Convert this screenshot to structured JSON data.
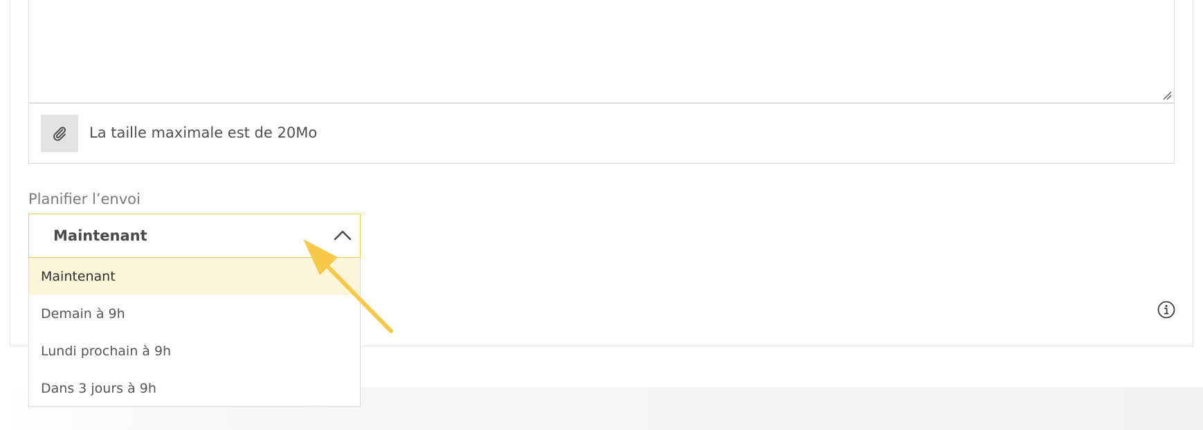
{
  "attachment": {
    "icon": "paperclip-icon",
    "hint": "La taille maximale est de 20Mo"
  },
  "schedule": {
    "label": "Planifier l’envoi",
    "selected_value": "Maintenant",
    "is_open": true,
    "options": [
      {
        "label": "Maintenant",
        "selected": true
      },
      {
        "label": "Demain à 9h",
        "selected": false
      },
      {
        "label": "Lundi prochain à 9h",
        "selected": false
      },
      {
        "label": "Dans 3 jours à 9h",
        "selected": false
      }
    ]
  },
  "icons": {
    "toggle": "chevron-up-icon",
    "info": "info-icon",
    "resize": "resize-handle-icon",
    "annotation": "arrow-annotation"
  },
  "colors": {
    "accent_border": "#f5cd47",
    "selected_option_bg": "#fdf6da",
    "annotation_arrow": "#f7c948",
    "attach_button_bg": "#e3e3e3"
  }
}
